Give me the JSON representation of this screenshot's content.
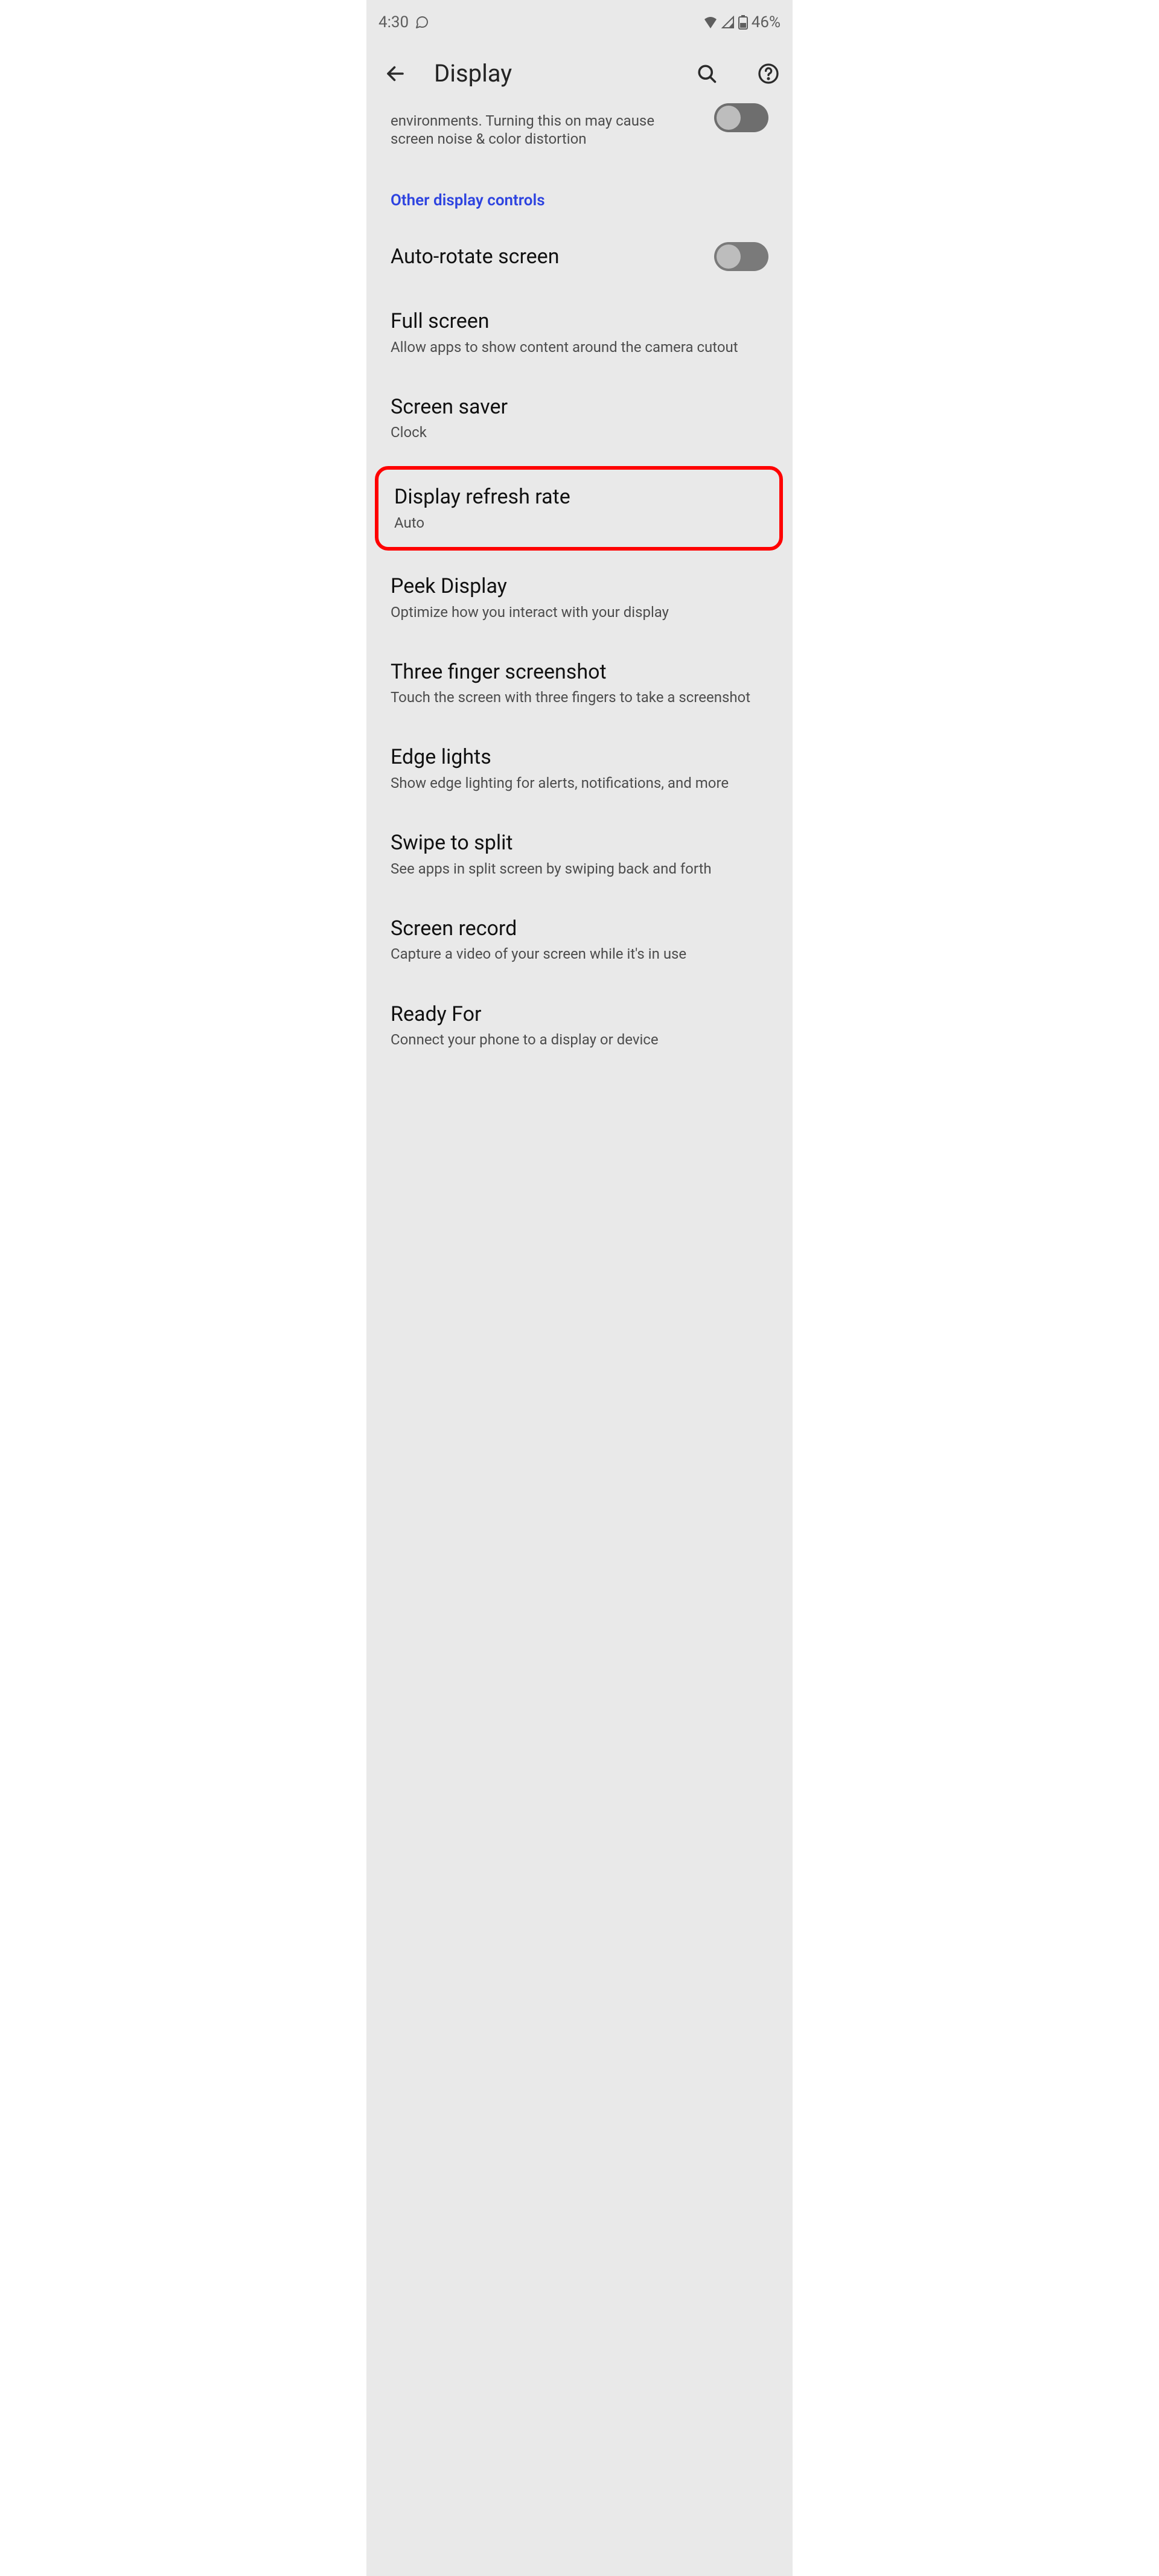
{
  "status_bar": {
    "time": "4:30",
    "battery_label": "46%"
  },
  "app_bar": {
    "title": "Display"
  },
  "partial_item": {
    "subtitle_fragment": "environments. Turning this on may cause screen noise & color distortion"
  },
  "section_header": "Other display controls",
  "items": [
    {
      "key": "auto-rotate",
      "title": "Auto-rotate screen",
      "subtitle": "",
      "has_switch": true,
      "switch_on": false
    },
    {
      "key": "full-screen",
      "title": "Full screen",
      "subtitle": "Allow apps to show content around the camera cutout"
    },
    {
      "key": "screen-saver",
      "title": "Screen saver",
      "subtitle": "Clock"
    },
    {
      "key": "display-refresh-rate",
      "title": "Display refresh rate",
      "subtitle": "Auto",
      "highlighted": true
    },
    {
      "key": "peek-display",
      "title": "Peek Display",
      "subtitle": "Optimize how you interact with your display"
    },
    {
      "key": "three-finger-screenshot",
      "title": "Three finger screenshot",
      "subtitle": "Touch the screen with three fingers to take a screenshot"
    },
    {
      "key": "edge-lights",
      "title": "Edge lights",
      "subtitle": "Show edge lighting for alerts, notifications, and more"
    },
    {
      "key": "swipe-to-split",
      "title": "Swipe to split",
      "subtitle": "See apps in split screen by swiping back and forth"
    },
    {
      "key": "screen-record",
      "title": "Screen record",
      "subtitle": "Capture a video of your screen while it's in use"
    },
    {
      "key": "ready-for",
      "title": "Ready For",
      "subtitle": "Connect your phone to a display or device"
    }
  ]
}
